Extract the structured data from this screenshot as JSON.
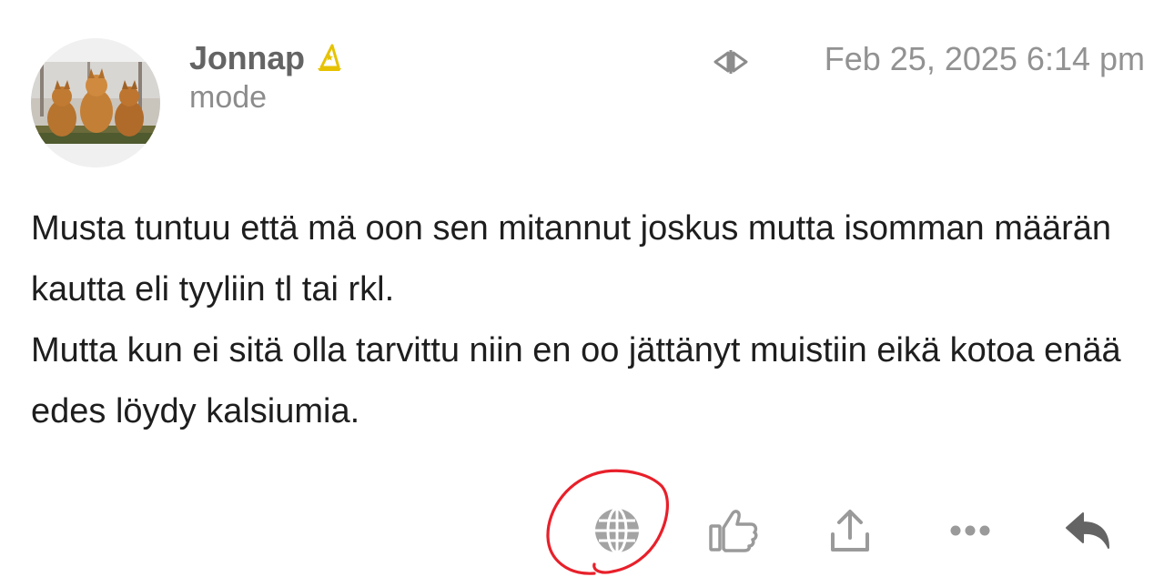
{
  "post": {
    "author": {
      "username": "Jonnap",
      "title": "mode",
      "flair_icon": "wizard-hat-icon",
      "flair_color": "#e6c200"
    },
    "date": "Feb 25, 2025 6:14 pm",
    "translate_icon": "translate-icon",
    "body_paragraphs": [
      "Musta tuntuu että mä oon sen mitannut joskus mutta isomman määrän kautta eli tyyliin tl tai rkl.",
      "Mutta kun ei sitä olla tarvittu niin en oo jättänyt muistiin eikä kotoa enää edes löydy kalsiumia."
    ],
    "actions": [
      {
        "icon": "globe-icon",
        "name": "translate-post-button"
      },
      {
        "icon": "thumbs-up-icon",
        "name": "like-button"
      },
      {
        "icon": "share-icon",
        "name": "share-button"
      },
      {
        "icon": "ellipsis-icon",
        "name": "more-options-button"
      },
      {
        "icon": "reply-icon",
        "name": "reply-button"
      }
    ],
    "annotation_color": "#e8202a"
  },
  "colors": {
    "icon_gray": "#9a9a9a",
    "reply_gray": "#646464",
    "text": "#1e1e1e",
    "muted": "#929292"
  }
}
